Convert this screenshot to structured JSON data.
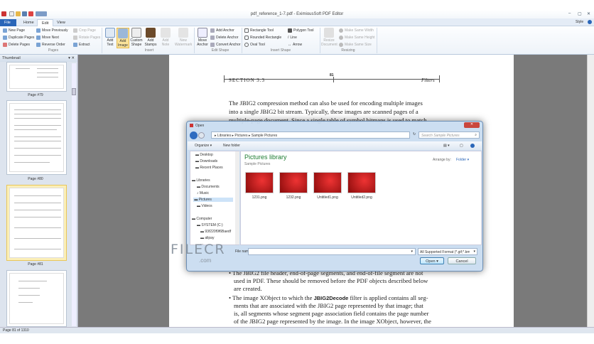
{
  "window": {
    "title": "pdf_reference_1-7.pdf - EximiousSoft PDF Editor",
    "style_label": "Style"
  },
  "tabs": [
    "File",
    "Home",
    "Edit",
    "View"
  ],
  "ribbon": {
    "pages": {
      "label": "Pages",
      "items": [
        "New Page",
        "Duplicate Pages",
        "Delete Pages",
        "Move Previously",
        "Move Next",
        "Reverse Order",
        "Crop Page",
        "Rotate Pages",
        "Extract"
      ]
    },
    "insert": {
      "label": "Insert",
      "items": [
        "Add Text",
        "Add Image",
        "Custom Shape",
        "Add Stamps",
        "Add Note",
        "New Watermark"
      ]
    },
    "edit_shape": {
      "label": "Edit Shape",
      "items": [
        "Move Anchor",
        "Add Anchor",
        "Delete Anchor",
        "Convert Anchor"
      ]
    },
    "insert_shape": {
      "label": "Insert Shape",
      "items": [
        "Rectangle Tool",
        "Rounded Rectangle",
        "Oval Tool",
        "Polygon Tool",
        "Line",
        "Arrow"
      ]
    },
    "resizing": {
      "label": "Resizing",
      "items": [
        "Resize Document",
        "Make Same Width",
        "Make Same Height",
        "Make Same Size"
      ]
    }
  },
  "thumbnails": {
    "title": "Thumbnail",
    "pages": [
      "Page #79",
      "Page #80",
      "Page #81"
    ]
  },
  "document": {
    "section": "SECTION 3.3",
    "page_number": "81",
    "running_head": "Filters",
    "para1": [
      "The JBIG2 compression method can also be used for encoding multiple images",
      "into a single JBIG2 bit stream. Typically, these images are scanned pages of a",
      "multiple-page document. Since a single table of symbol bitmaps is used to match"
    ],
    "bullet1": [
      "The JBIG2 file header, end-of-page segments, and end-of-file segment are not",
      "used in PDF. These should be removed before the PDF objects described below",
      "are created."
    ],
    "bullet2_pre": "The image XObject to which the ",
    "bullet2_bold": "JBIG2Decode",
    "bullet2_post": " filter is applied contains all seg-",
    "bullet2": [
      "ments that are associated with the JBIG2 page represented by that image; that",
      "is, all segments whose segment page association field contains the page number",
      "of the JBIG2 page represented by the image. In the image XObject, however, the"
    ]
  },
  "dialog": {
    "title": "Open",
    "breadcrumb": [
      "Libraries",
      "Pictures",
      "Sample Pictures"
    ],
    "search_placeholder": "Search Sample Pictures",
    "organize": "Organize",
    "new_folder": "New folder",
    "nav": [
      "Desktop",
      "Downloads",
      "Recent Places",
      "Libraries",
      "Documents",
      "Music",
      "Pictures",
      "Videos",
      "Computer",
      "SYSTEM (C:)",
      "93f220f9f6Baedf",
      "alipay",
      "..."
    ],
    "library_title": "Pictures library",
    "library_sub": "Sample Pictures",
    "arrange_label": "Arrange by:",
    "arrange_value": "Folder",
    "files": [
      "1231.png",
      "1232.png",
      "Untitled1.png",
      "Untitled2.png"
    ],
    "file_name_label": "File name:",
    "file_name_value": "",
    "file_type": "All Supported Format (*.gif;*.bmp",
    "open": "Open",
    "cancel": "Cancel"
  },
  "watermark": {
    "text": "FILECR",
    "sub": ".com"
  },
  "status": "Page 81 of 1310"
}
